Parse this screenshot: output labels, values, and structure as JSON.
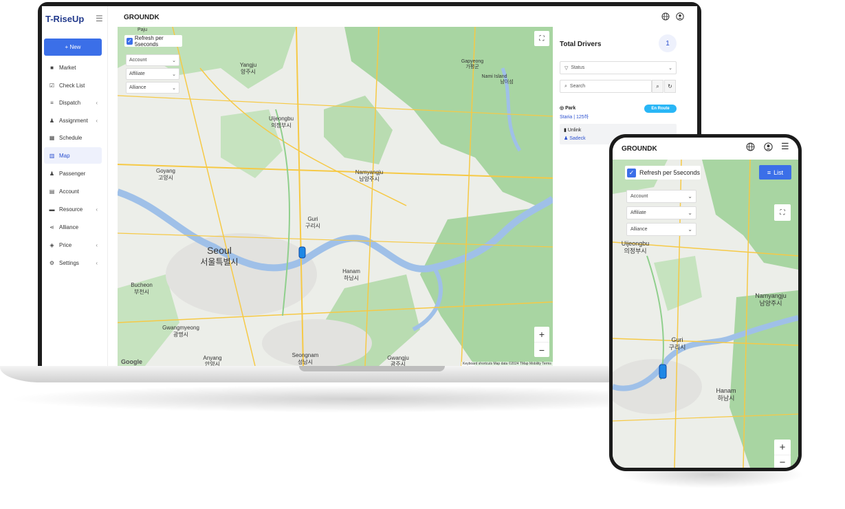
{
  "desktop": {
    "logo": "T-RiseUp",
    "new_button": "+ New",
    "nav": [
      {
        "label": "Market",
        "icon": "bag-icon"
      },
      {
        "label": "Check List",
        "icon": "checklist-icon"
      },
      {
        "label": "Dispatch",
        "icon": "list-icon",
        "chevron": "‹"
      },
      {
        "label": "Assignment",
        "icon": "user-plus-icon",
        "chevron": "‹"
      },
      {
        "label": "Schedule",
        "icon": "calendar-icon"
      },
      {
        "label": "Map",
        "icon": "map-icon",
        "active": true
      },
      {
        "label": "Passenger",
        "icon": "users-icon"
      },
      {
        "label": "Account",
        "icon": "account-icon"
      },
      {
        "label": "Resource",
        "icon": "folder-icon",
        "chevron": "‹"
      },
      {
        "label": "Alliance",
        "icon": "share-icon"
      },
      {
        "label": "Price",
        "icon": "tag-icon",
        "chevron": "‹"
      },
      {
        "label": "Settings",
        "icon": "gear-icon",
        "chevron": "‹"
      }
    ],
    "header_title": "GROUNDK",
    "map": {
      "refresh_label": "Refresh per 5seconds",
      "filters": [
        "Account",
        "Affiliate",
        "Alliance"
      ],
      "zoom_in": "+",
      "zoom_out": "−",
      "attribution": "Keyboard shortcuts   Map data ©2024 TMap Mobility   Terms",
      "google_logo": "Google",
      "places": [
        {
          "en": "Seoul",
          "ko": "서울특별시"
        },
        {
          "en": "Goyang",
          "ko": "고양시"
        },
        {
          "en": "Bucheon",
          "ko": "부천시"
        },
        {
          "en": "Gwangmyeong",
          "ko": "광명시"
        },
        {
          "en": "Anyang",
          "ko": "안양시"
        },
        {
          "en": "Seongnam",
          "ko": "성남시"
        },
        {
          "en": "Gwangju",
          "ko": "광주시"
        },
        {
          "en": "Hanam",
          "ko": "하남시"
        },
        {
          "en": "Guri",
          "ko": "구리시"
        },
        {
          "en": "Namyangju",
          "ko": "남양주시"
        },
        {
          "en": "Uijeongbu",
          "ko": "의정부시"
        },
        {
          "en": "Yangju",
          "ko": "양주시"
        },
        {
          "en": "Paju",
          "ko": ""
        },
        {
          "en": "Gapyeong",
          "ko": "가평군"
        },
        {
          "en": "Nami Island",
          "ko": "남이섬"
        }
      ]
    },
    "panel": {
      "title": "Total Drivers",
      "count": "1",
      "status_placeholder": "Status",
      "search_placeholder": "Search",
      "driver": {
        "name": "Park",
        "car": "Staria | 125하",
        "status": "En Route",
        "link": "Unlink",
        "owner": "Sadeck"
      }
    }
  },
  "mobile": {
    "title": "GROUNDK",
    "refresh_label": "Refresh per 5seconds",
    "list_button": "List",
    "filters": [
      "Account",
      "Affiliate",
      "Alliance"
    ],
    "zoom_in": "+",
    "zoom_out": "−",
    "places": [
      {
        "en": "Uijeongbu",
        "ko": "의정부시"
      },
      {
        "en": "Namyangju",
        "ko": "남양주시"
      },
      {
        "en": "Guri",
        "ko": "구리시"
      },
      {
        "en": "Hanam",
        "ko": "하남시"
      }
    ]
  },
  "colors": {
    "accent": "#3b6fe8",
    "status_en_route": "#29b6f6",
    "map_green": "#a8d5a2",
    "map_river": "#9fc0e8",
    "map_road": "#f6c945"
  }
}
